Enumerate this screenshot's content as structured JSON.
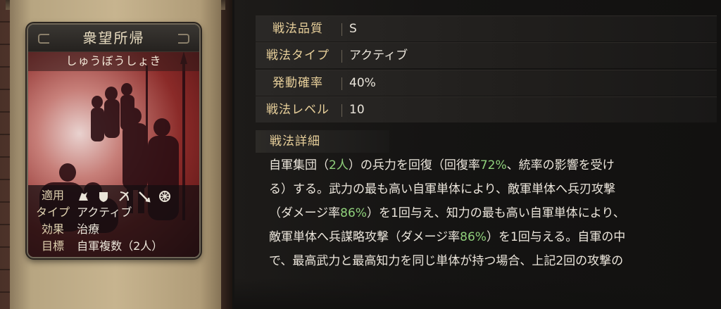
{
  "card": {
    "name": "衆望所帰",
    "reading": "しゅうぼうしょき",
    "info": [
      {
        "label": "適用",
        "icons": [
          "cavalry-icon",
          "shield-icon",
          "archer-icon",
          "spear-icon",
          "chariot-icon"
        ]
      },
      {
        "label": "タイプ",
        "value": "アクティブ"
      },
      {
        "label": "効果",
        "value": "治療"
      },
      {
        "label": "目標",
        "value": "自軍複数（2人）"
      }
    ]
  },
  "stats": [
    {
      "label": "戦法品質",
      "value": "S"
    },
    {
      "label": "戦法タイプ",
      "value": "アクティブ"
    },
    {
      "label": "発動確率",
      "value": "40%"
    },
    {
      "label": "戦法レベル",
      "value": "10"
    }
  ],
  "detail": {
    "heading": "戦法詳細",
    "lines": [
      [
        {
          "t": "自軍集団（"
        },
        {
          "t": "2人",
          "hl": true
        },
        {
          "t": "）の兵力を回復（回復率"
        },
        {
          "t": "72%",
          "hl": true
        },
        {
          "t": "、統率の影響を受け"
        }
      ],
      [
        {
          "t": "る）する。武力の最も高い自軍単体により、敵軍単体へ兵刃攻撃"
        }
      ],
      [
        {
          "t": "（ダメージ率"
        },
        {
          "t": "86%",
          "hl": true
        },
        {
          "t": "）を1回与え、知力の最も高い自軍単体により、"
        }
      ],
      [
        {
          "t": "敵軍単体へ兵謀略攻撃（ダメージ率"
        },
        {
          "t": "86%",
          "hl": true
        },
        {
          "t": "）を1回与える。自軍の中"
        }
      ],
      [
        {
          "t": "で、最高武力と最高知力を同じ単体が持つ場合、上記2回の攻撃の"
        }
      ]
    ]
  },
  "colors": {
    "highlight": "#8fd07b",
    "label_gold": "#e7cf9a"
  }
}
